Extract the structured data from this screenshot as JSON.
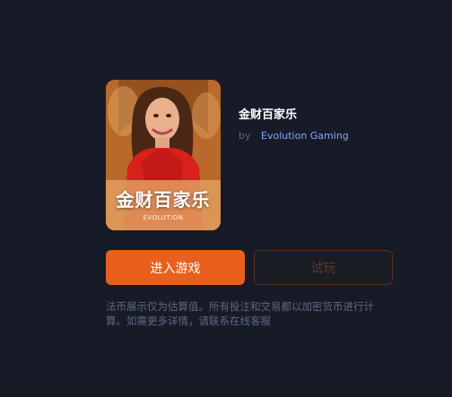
{
  "game": {
    "thumbnail_title": "金财百家乐",
    "thumbnail_brand": "EVOLUTION",
    "title": "金财百家乐",
    "provider_prefix": "by",
    "provider_name": "Evolution Gaming"
  },
  "actions": {
    "enter_label": "进入游戏",
    "trial_label": "试玩"
  },
  "notice": "法币展示仅为估算值。所有投注和交易都以加密货币进行计算。如需更多详情，请联系在线客服",
  "colors": {
    "background": "#161b27",
    "accent": "#e8601c",
    "provider_link": "#8ba3ff"
  }
}
